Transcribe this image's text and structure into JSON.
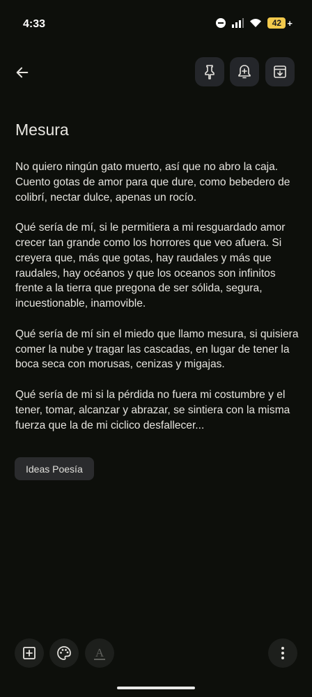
{
  "status": {
    "time": "4:33",
    "battery": "42",
    "battery_suffix": "+"
  },
  "note": {
    "title": "Mesura",
    "paragraphs": [
      "No quiero ningún gato muerto, así que no abro la caja. Cuento gotas de amor para que dure, como bebedero de colibrí, nectar dulce, apenas un rocío.",
      "Qué sería de mí, si le permitiera a mi resguardado amor crecer tan grande como los horrores que veo afuera. Si creyera que, más que gotas, hay raudales y más que raudales, hay océanos y que los oceanos son infinitos frente a la tierra que pregona de ser sólida, segura, incuestionable, inamovible.",
      "Qué sería de mí sin el miedo que llamo mesura, si quisiera comer la nube y tragar las cascadas, en lugar de tener la boca seca con morusas, cenizas y migajas.",
      "Qué sería de mi si la pérdida no fuera mi costumbre y el tener, tomar, alcanzar y abrazar, se sintiera con la misma fuerza que la de mi ciclico desfallecer..."
    ],
    "label": "Ideas Poesía"
  },
  "icons": {
    "back": "arrow-back-icon",
    "pin": "pin-icon",
    "reminder": "bell-plus-icon",
    "archive": "archive-icon",
    "add": "add-box-icon",
    "palette": "palette-icon",
    "format": "text-format-icon",
    "more": "more-vert-icon"
  },
  "colors": {
    "background": "#0d0f0b",
    "button": "#24262a",
    "chip": "#2a2b2d",
    "battery": "#f2c94c"
  }
}
